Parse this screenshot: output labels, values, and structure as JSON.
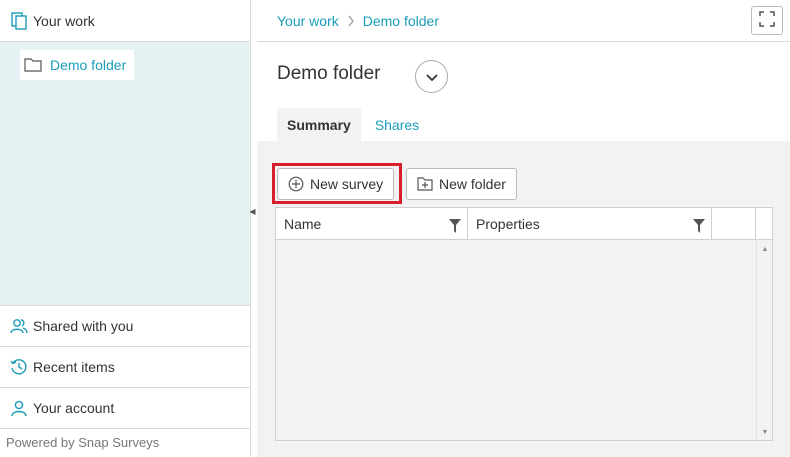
{
  "sidebar": {
    "header": {
      "label": "Your work",
      "icon": "documents-icon"
    },
    "tree": [
      {
        "label": "Demo folder",
        "icon": "folder-icon"
      }
    ],
    "nav": [
      {
        "label": "Shared with you",
        "icon": "shared-users-icon"
      },
      {
        "label": "Recent items",
        "icon": "history-clock-icon"
      },
      {
        "label": "Your account",
        "icon": "user-icon"
      }
    ],
    "footer": "Powered by Snap Surveys"
  },
  "breadcrumb": [
    "Your work",
    "Demo folder"
  ],
  "page": {
    "title": "Demo folder",
    "tabs": [
      "Summary",
      "Shares"
    ],
    "active_tab": "Summary"
  },
  "toolbar": {
    "new_survey": "New survey",
    "new_folder": "New folder"
  },
  "grid": {
    "columns": [
      "Name",
      "Properties"
    ],
    "rows": []
  },
  "colors": {
    "accent": "#1a9db8",
    "highlight": "#d81e2a",
    "tree_bg": "#e7f2f5",
    "content_bg": "#f2f2f2"
  }
}
